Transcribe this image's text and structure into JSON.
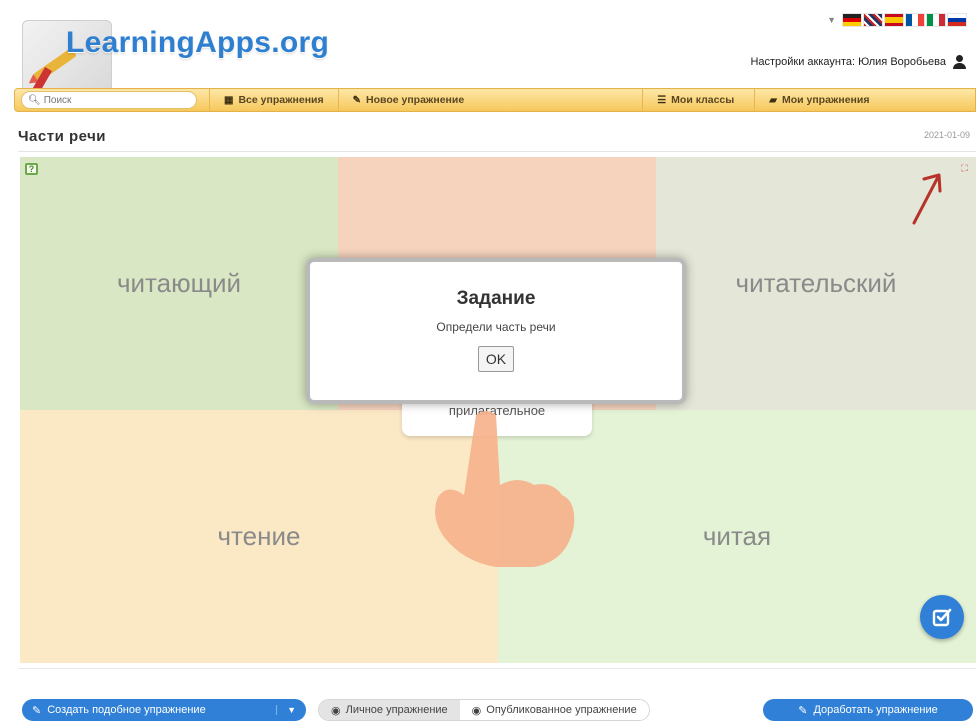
{
  "header": {
    "logo_text": "LearningApps.org",
    "account_label": "Настройки аккаунта: Юлия Воробьева"
  },
  "languages": [
    "de",
    "gb",
    "es",
    "fr",
    "it",
    "ru"
  ],
  "nav": {
    "search_placeholder": "Поиск",
    "items": [
      {
        "label": "Все упражнения",
        "icon": "grid-icon"
      },
      {
        "label": "Новое упражнение",
        "icon": "pencil-icon"
      },
      {
        "label": "Мои классы",
        "icon": "list-icon"
      },
      {
        "label": "Мои упражнения",
        "icon": "folder-icon"
      }
    ]
  },
  "page": {
    "title": "Части речи",
    "date": "2021-01-09"
  },
  "exercise": {
    "words": {
      "top_left": "читающий",
      "top_right": "читательский",
      "bottom_left": "чтение",
      "bottom_right": "читая"
    },
    "card_text": "прилагательное",
    "modal": {
      "title": "Задание",
      "text": "Определи часть речи",
      "ok_label": "OK"
    },
    "colors": {
      "top_left": "#d9e7c4",
      "top_middle": "#f5d3bd",
      "top_right": "#e4e6d8",
      "bottom_left": "#fbe9c6",
      "bottom_right": "#e4f3d6"
    }
  },
  "footer": {
    "create_label": "Создать подобное упражнение",
    "private_label": "Личное упражнение",
    "public_label": "Опубликованное упражнение",
    "improve_label": "Доработать упражнение"
  },
  "accent_color": "#2f80d6"
}
